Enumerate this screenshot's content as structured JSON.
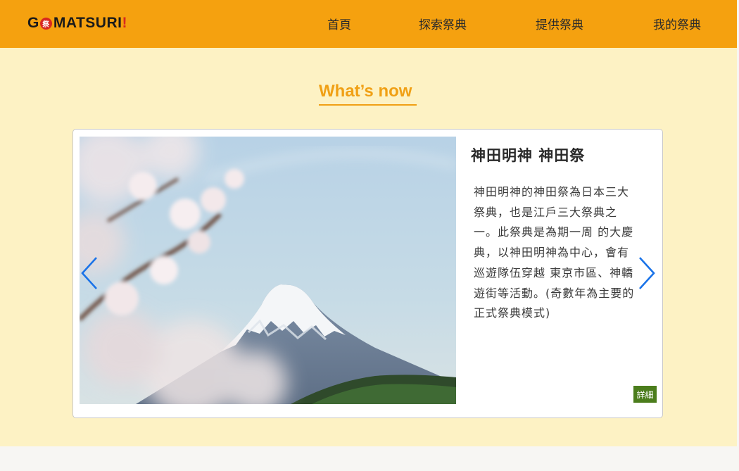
{
  "brand": {
    "prefix": "G",
    "badge": "祭",
    "name": " MATSURI",
    "bang": "!",
    "colors": {
      "bar": "#f5a10f",
      "badge": "#d8281f"
    }
  },
  "nav": {
    "home": "首頁",
    "explore": "探索祭典",
    "provide": "提供祭典",
    "mine": "我的祭典"
  },
  "section": {
    "title": "What’s now",
    "accent": "#f0a015",
    "background": "#fdf2c4"
  },
  "card": {
    "image": {
      "subject": "Mount Fuji with cherry blossoms",
      "icon": "mountain-photo"
    },
    "title": "神田明神 神田祭",
    "description": "神田明神的神田祭為日本三大 祭典，也是江戶三大祭典之一。此祭典是為期一周 的大慶典，以神田明神為中心，會有巡遊隊伍穿越 東京市區、神轎遊街等活動。(奇數年為主要的正式祭典模式)",
    "detail_label": "詳細",
    "detail_color": "#4b7d1c"
  },
  "carousel": {
    "prev_icon": "chevron-left-icon",
    "next_icon": "chevron-right-icon",
    "arrow_color": "#1a73e8"
  }
}
